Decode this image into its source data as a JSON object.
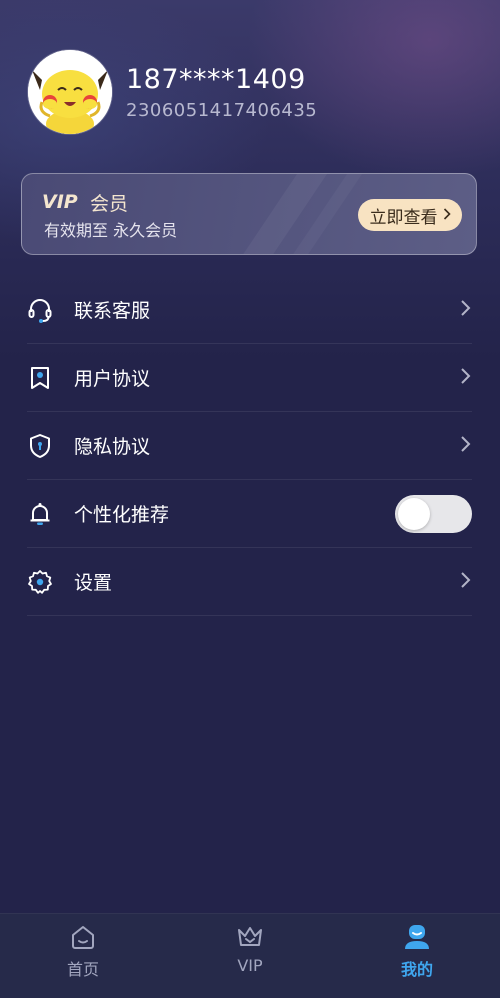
{
  "profile": {
    "phone": "187****1409",
    "user_id": "2306051417406435"
  },
  "vip_card": {
    "badge": "VIP",
    "title": "会员",
    "validity": "有效期至 永久会员",
    "button_label": "立即查看"
  },
  "menu": {
    "items": [
      {
        "label": "联系客服",
        "icon": "headset-icon",
        "control": "chevron"
      },
      {
        "label": "用户协议",
        "icon": "bookmark-badge-icon",
        "control": "chevron"
      },
      {
        "label": "隐私协议",
        "icon": "shield-icon",
        "control": "chevron"
      },
      {
        "label": "个性化推荐",
        "icon": "bell-icon",
        "control": "toggle",
        "toggle_on": false
      },
      {
        "label": "设置",
        "icon": "gear-icon",
        "control": "chevron"
      }
    ]
  },
  "tabbar": {
    "tabs": [
      {
        "label": "首页",
        "icon": "home-icon",
        "active": false
      },
      {
        "label": "VIP",
        "icon": "crown-icon",
        "active": false
      },
      {
        "label": "我的",
        "icon": "profile-icon",
        "active": true
      }
    ]
  },
  "colors": {
    "background": "#23234a",
    "vip_gold": "#f8e3c2",
    "active_tab": "#3fa6ee"
  }
}
